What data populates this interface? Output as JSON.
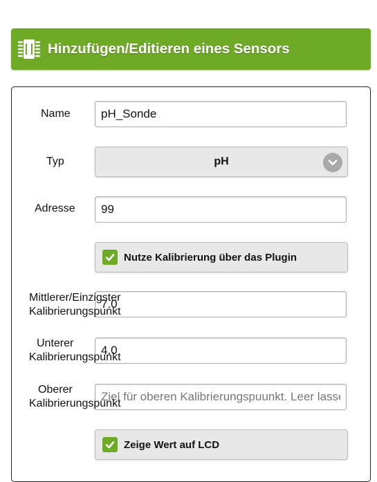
{
  "header": {
    "title": "Hinzufügen/Editieren eines Sensors",
    "icon": "chip-icon",
    "accent_color": "#6faa26"
  },
  "form": {
    "name": {
      "label": "Name",
      "value": "pH_Sonde"
    },
    "type": {
      "label": "Typ",
      "selected": "pH"
    },
    "address": {
      "label": "Adresse",
      "value": "99"
    },
    "use_calibration": {
      "label": "Nutze Kalibrierung über das Plugin",
      "checked": true
    },
    "mid_calibration": {
      "label_line1": "Mittlerer/Einzigster",
      "label_line2": "Kalibrierungspunkt",
      "value": "7.0"
    },
    "lower_calibration": {
      "label_line1": "Unterer",
      "label_line2": "Kalibrierungspunkt",
      "value": "4.0"
    },
    "upper_calibration": {
      "label_line1": "Oberer",
      "label_line2": "Kalibrierungspunkt",
      "value": "",
      "placeholder": "Ziel für oberen Kalibrierungspuunkt. Leer lassen"
    },
    "show_on_lcd": {
      "label": "Zeige Wert auf LCD",
      "checked": true
    }
  }
}
